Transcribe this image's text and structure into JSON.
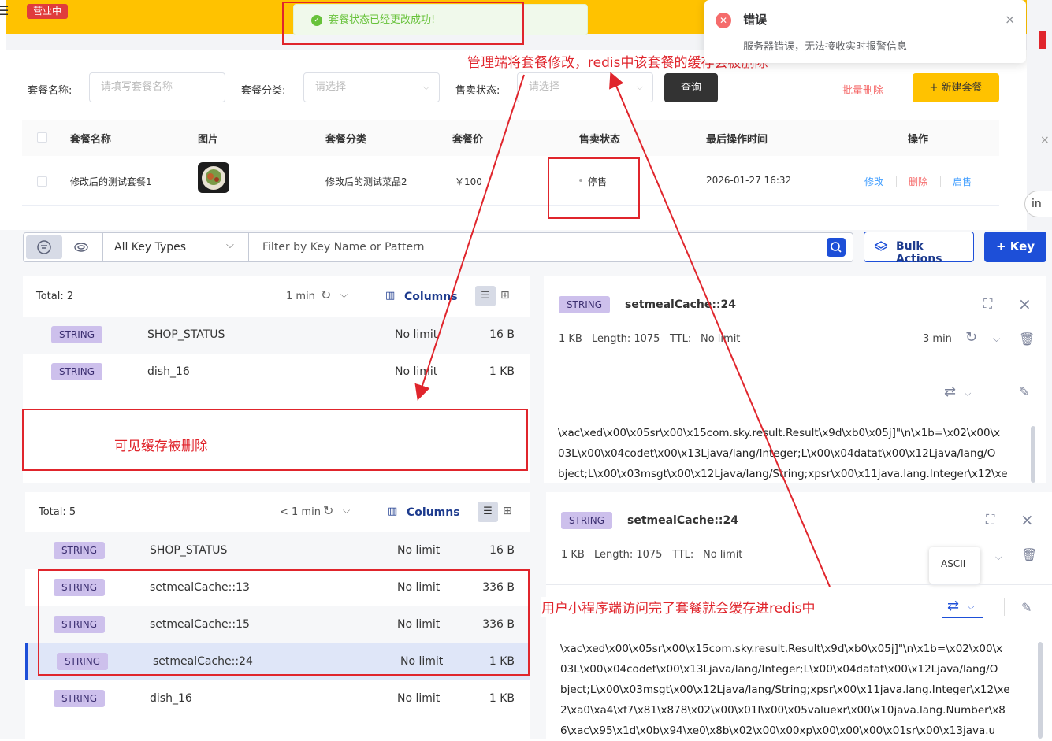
{
  "admin": {
    "status_badge": "营业中",
    "success_toast": "套餐状态已经更改成功!",
    "filters": {
      "name_label": "套餐名称:",
      "name_placeholder": "请填写套餐名称",
      "category_label": "套餐分类:",
      "category_placeholder": "请选择",
      "sale_label": "售卖状态:",
      "sale_placeholder": "请选择"
    },
    "query_button": "查询",
    "batch_delete": "批量删除",
    "new_button": "+ 新建套餐",
    "table": {
      "headers": [
        "套餐名称",
        "图片",
        "套餐分类",
        "套餐价",
        "售卖状态",
        "最后操作时间",
        "操作"
      ],
      "row": {
        "name": "修改后的测试套餐1",
        "category": "修改后的测试菜品2",
        "price": "￥100",
        "status": "停售",
        "updated": "2026-01-27 16:32",
        "actions": [
          "修改",
          "删除",
          "启售"
        ]
      }
    }
  },
  "error_toast": {
    "title": "错误",
    "message": "服务器错误，无法接收实时报警信息"
  },
  "annotations": {
    "admin_modified": "管理端将套餐修改，redis中该套餐的缓存会被删除",
    "cache_deleted": "可见缓存被删除",
    "user_cached": "用户小程序端访问完了套餐就会缓存进redis中"
  },
  "redis": {
    "key_type_select": "All Key Types",
    "filter_placeholder": "Filter by Key Name or Pattern",
    "bulk_actions": "Bulk Actions",
    "add_key": "+ Key",
    "side_partial": "in",
    "top_list": {
      "total": "Total: 2",
      "refresh_age": "1 min",
      "columns": "Columns",
      "rows": [
        {
          "type": "STRING",
          "key": "SHOP_STATUS",
          "ttl": "No limit",
          "size": "16 B"
        },
        {
          "type": "STRING",
          "key": "dish_16",
          "ttl": "No limit",
          "size": "1 KB"
        }
      ]
    },
    "top_detail": {
      "type": "STRING",
      "key": "setmealCache::24",
      "size": "1 KB",
      "length": "Length: 1075",
      "ttl_label": "TTL:",
      "ttl": "No limit",
      "refresh_age": "3 min",
      "value_lines": [
        "\\xac\\xed\\x00\\x05sr\\x00\\x15com.sky.result.Result\\x9d\\xb0\\x05j]\"\\n\\x1b=\\x02\\x00\\x",
        "03L\\x00\\x04codet\\x00\\x13Ljava/lang/Integer;L\\x00\\x04datat\\x00\\x12Ljava/lang/O",
        "bject;L\\x00\\x03msgt\\x00\\x12Ljava/lang/String;xpsr\\x00\\x11java.lang.Integer\\x12\\xe"
      ]
    },
    "bottom_list": {
      "total": "Total: 5",
      "refresh_age": "< 1 min",
      "columns": "Columns",
      "rows": [
        {
          "type": "STRING",
          "key": "SHOP_STATUS",
          "ttl": "No limit",
          "size": "16 B"
        },
        {
          "type": "STRING",
          "key": "setmealCache::13",
          "ttl": "No limit",
          "size": "336 B"
        },
        {
          "type": "STRING",
          "key": "setmealCache::15",
          "ttl": "No limit",
          "size": "336 B"
        },
        {
          "type": "STRING",
          "key": "setmealCache::24",
          "ttl": "No limit",
          "size": "1 KB"
        },
        {
          "type": "STRING",
          "key": "dish_16",
          "ttl": "No limit",
          "size": "1 KB"
        }
      ]
    },
    "bottom_detail": {
      "type": "STRING",
      "key": "setmealCache::24",
      "size": "1 KB",
      "length": "Length: 1075",
      "ttl_label": "TTL:",
      "ttl": "No limit",
      "tooltip": "ASCII",
      "value_lines": [
        "\\xac\\xed\\x00\\x05sr\\x00\\x15com.sky.result.Result\\x9d\\xb0\\x05j]\"\\n\\x1b=\\x02\\x00\\x",
        "03L\\x00\\x04codet\\x00\\x13Ljava/lang/Integer;L\\x00\\x04datat\\x00\\x12Ljava/lang/O",
        "bject;L\\x00\\x03msgt\\x00\\x12Ljava/lang/String;xpsr\\x00\\x11java.lang.Integer\\x12\\xe",
        "2\\xa0\\xa4\\xf7\\x81\\x878\\x02\\x00\\x01I\\x00\\x05valuexr\\x00\\x10java.lang.Number\\x8",
        "6\\xac\\x95\\x1d\\x0b\\x94\\xe0\\x8b\\x02\\x00\\x00xp\\x00\\x00\\x00\\x01sr\\x00\\x13java.u"
      ]
    }
  }
}
